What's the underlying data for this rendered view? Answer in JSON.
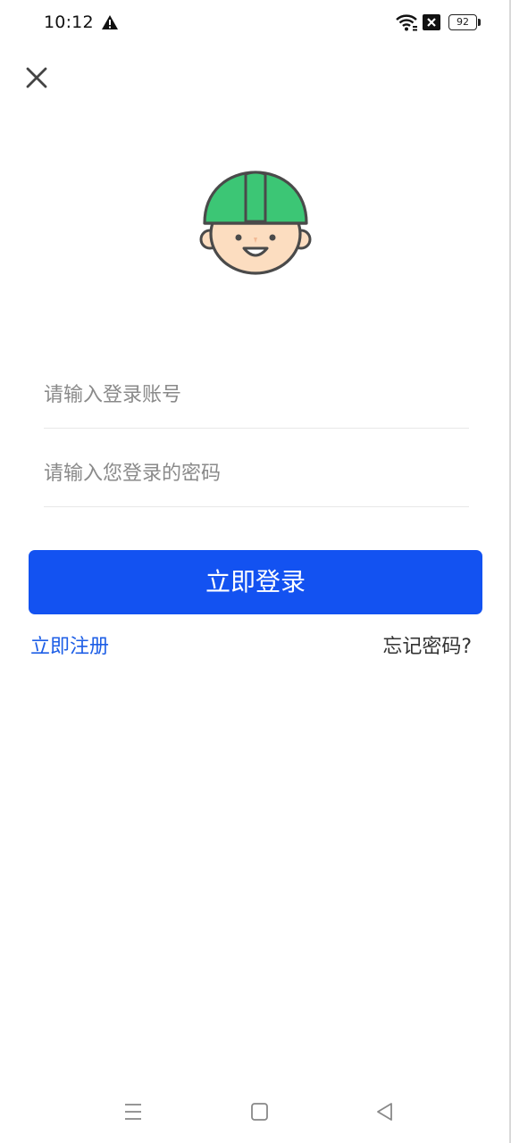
{
  "status_bar": {
    "time": "10:12",
    "battery_level": "92",
    "icons": [
      "warning-icon",
      "wifi-icon",
      "x-box-icon",
      "battery-icon"
    ]
  },
  "header": {
    "close_icon": "close-icon"
  },
  "avatar": {
    "icon": "worker-helmet-avatar-icon",
    "helmet_color": "#3CC675",
    "face_color": "#FCDDC0",
    "outline_color": "#4A4A4A"
  },
  "form": {
    "account_placeholder": "请输入登录账号",
    "account_value": "",
    "password_placeholder": "请输入您登录的密码",
    "password_value": ""
  },
  "actions": {
    "login_label": "立即登录",
    "register_label": "立即注册",
    "forgot_label": "忘记密码?"
  },
  "colors": {
    "accent": "#1352F1",
    "link": "#1D5EE6"
  },
  "nav_bar": {
    "icons": [
      "menu-icon",
      "home-square-icon",
      "back-triangle-icon"
    ]
  }
}
